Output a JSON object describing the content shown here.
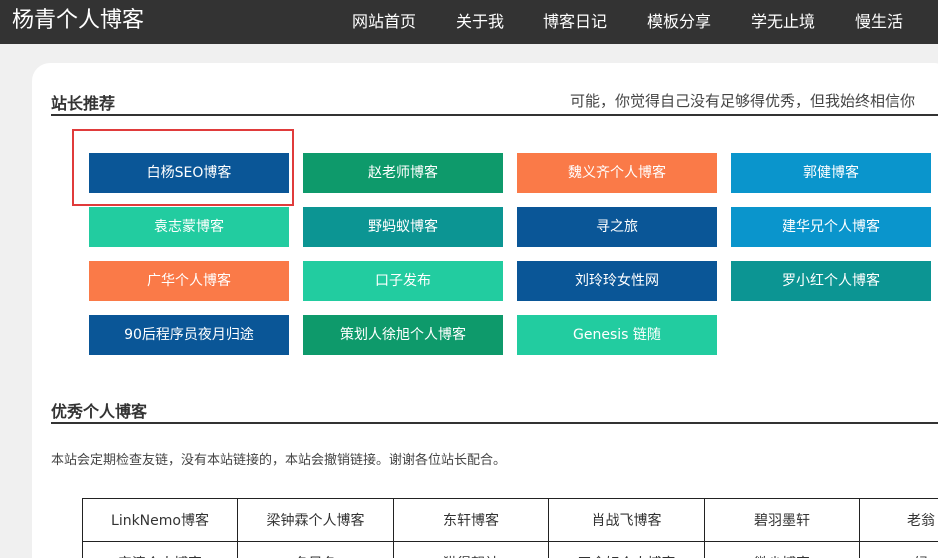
{
  "header": {
    "logo": "杨青个人博客",
    "nav": [
      "网站首页",
      "关于我",
      "博客日记",
      "模板分享",
      "学无止境",
      "慢生活"
    ]
  },
  "recommend": {
    "title": "站长推荐",
    "motto": "可能，你觉得自己没有足够得优秀，但我始终相信你",
    "links": [
      {
        "label": "白杨SEO博客",
        "color": "#0a5697"
      },
      {
        "label": "赵老师博客",
        "color": "#0e9a6b"
      },
      {
        "label": "魏义齐个人博客",
        "color": "#fa7a48"
      },
      {
        "label": "郭健博客",
        "color": "#0a95cc"
      },
      {
        "label": "袁志蒙博客",
        "color": "#22cca0"
      },
      {
        "label": "野蚂蚁博客",
        "color": "#0c9593"
      },
      {
        "label": "寻之旅",
        "color": "#0a5697"
      },
      {
        "label": "建华兄个人博客",
        "color": "#0a95cc"
      },
      {
        "label": "广华个人博客",
        "color": "#fa7a48"
      },
      {
        "label": "口子发布",
        "color": "#22cca0"
      },
      {
        "label": "刘玲玲女性网",
        "color": "#0a5697"
      },
      {
        "label": "罗小红个人博客",
        "color": "#0c9593"
      },
      {
        "label": "90后程序员夜月归途",
        "color": "#0a5697"
      },
      {
        "label": "策划人徐旭个人博客",
        "color": "#0e9a6b"
      },
      {
        "label": "Genesis 链随",
        "color": "#22cca0"
      }
    ]
  },
  "excellent": {
    "title": "优秀个人博客",
    "note": "本站会定期检查友链，没有本站链接的，本站会撤销链接。谢谢各位站长配合。",
    "rows": [
      [
        "LinkNemo博客",
        "梁钟霖个人博客",
        "东轩博客",
        "肖战飞博客",
        "碧羽墨轩",
        "老翁"
      ],
      [
        "安清个人博客",
        "冬风冬",
        "猫得靓社",
        "王金好个人博客",
        "微尘博客",
        "绿"
      ]
    ]
  }
}
